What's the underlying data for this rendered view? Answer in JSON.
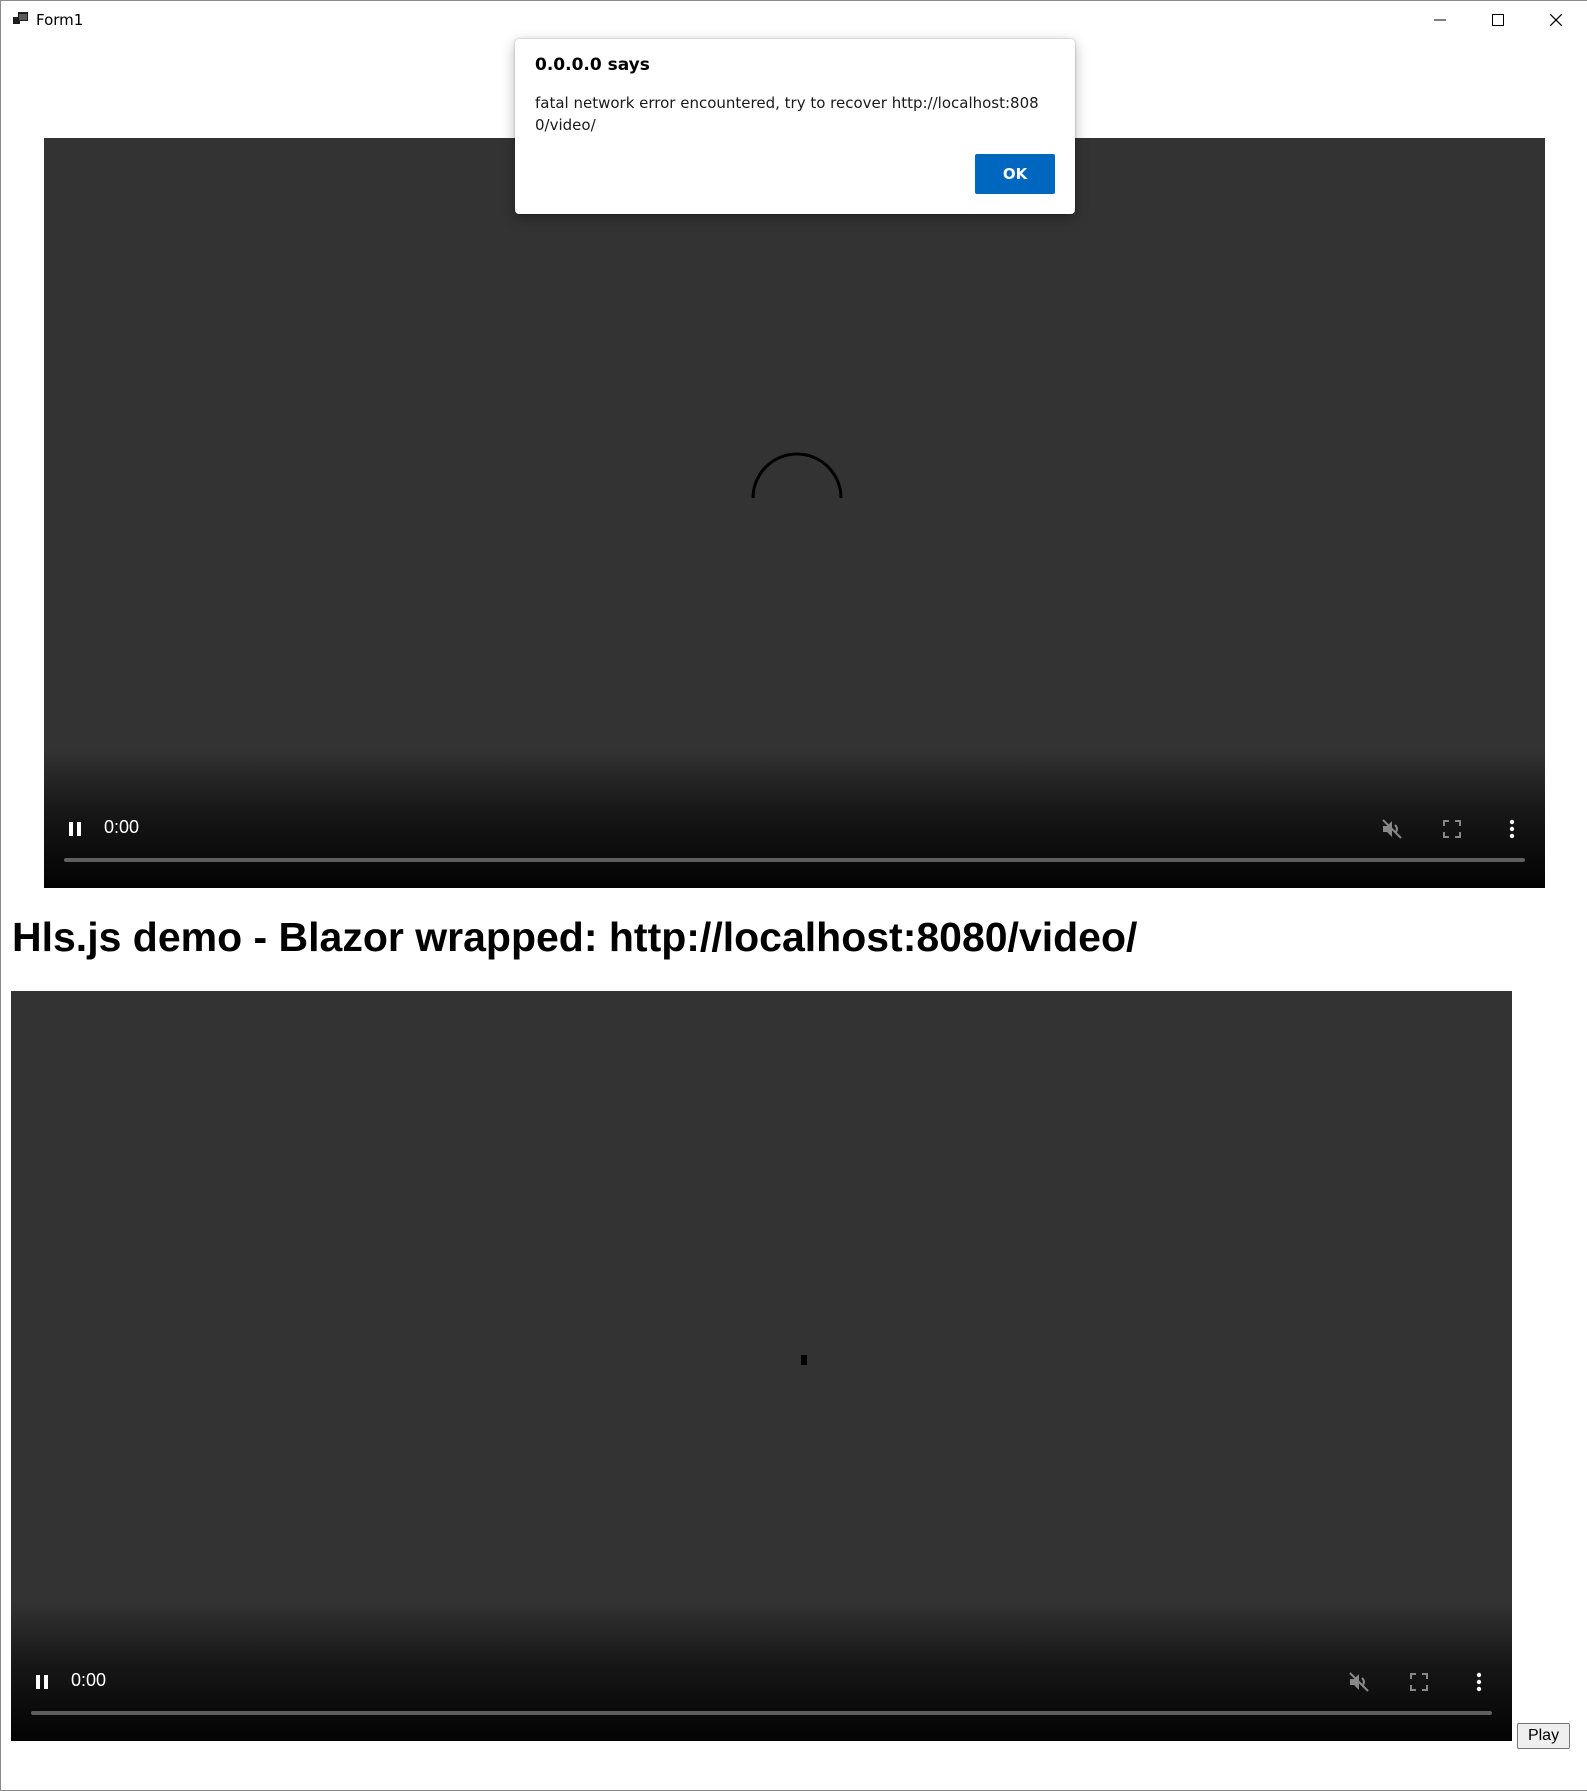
{
  "window": {
    "title": "Form1",
    "icons": {
      "app": "form-app-icon",
      "minimize": "minimize-icon",
      "maximize": "maximize-icon",
      "close": "close-icon"
    }
  },
  "dialog": {
    "title": "0.0.0.0 says",
    "message": "fatal network error encountered, try to recover http://localhost:8080/video/",
    "ok_label": "OK"
  },
  "video1": {
    "time": "0:00",
    "state": "loading",
    "icons": {
      "pause": "pause-icon",
      "mute": "muted-volume-icon",
      "fullscreen": "fullscreen-icon",
      "more": "more-options-icon"
    }
  },
  "heading": "Hls.js demo - Blazor wrapped: http://localhost:8080/video/",
  "video2": {
    "time": "0:00",
    "state": "loading",
    "icons": {
      "pause": "pause-icon",
      "mute": "muted-volume-icon",
      "fullscreen": "fullscreen-icon",
      "more": "more-options-icon"
    }
  },
  "play_button": {
    "label": "Play"
  },
  "colors": {
    "video_bg": "#333333",
    "ok_button": "#0067c0",
    "page_bg": "#ffffff"
  }
}
